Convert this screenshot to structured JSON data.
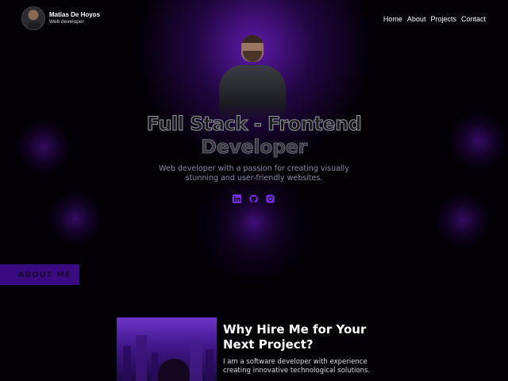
{
  "header": {
    "name": "Matias De Hoyos",
    "role": "Web developer"
  },
  "nav": {
    "items": [
      {
        "label": "Home"
      },
      {
        "label": "About"
      },
      {
        "label": "Projects"
      },
      {
        "label": "Contact"
      }
    ]
  },
  "hero": {
    "title_line1": "Full Stack - Frontend",
    "title_line2": "Developer",
    "subtitle": "Web developer with a passion for creating visually stunning and user-friendly websites.",
    "socials": [
      {
        "icon": "linkedin-icon"
      },
      {
        "icon": "github-icon"
      },
      {
        "icon": "instagram-icon"
      }
    ]
  },
  "about": {
    "tab_label": "ABOUT ME",
    "heading": "Why Hire Me for Your Next Project?",
    "text": "I am a software developer with experience creating innovative technological solutions."
  },
  "colors": {
    "accent": "#7a2cf0",
    "background": "#030006",
    "tab": "#3a0a80"
  }
}
